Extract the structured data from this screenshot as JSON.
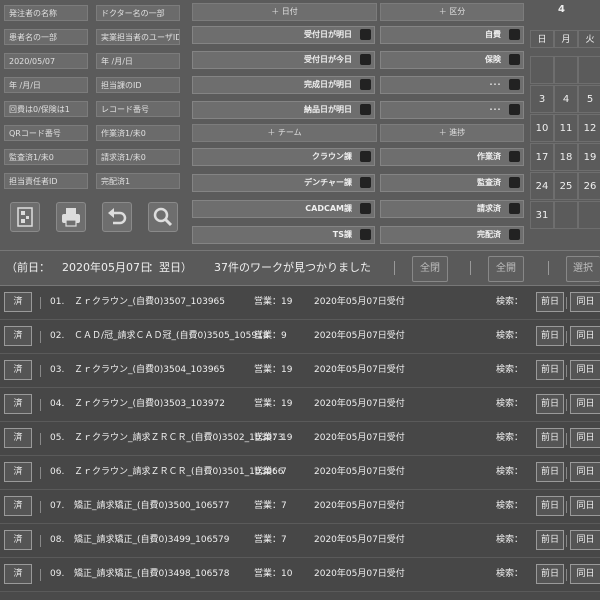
{
  "filters": {
    "left": [
      "発注者の名称",
      "患者名の一部",
      "2020/05/07",
      "年 /月/日",
      "回費は0/保険は1",
      "QRコード番号",
      "監査済1/未0",
      "担当責任者ID"
    ],
    "right": [
      "ドクター名の一部",
      "実業担当者のユーザID",
      "年 /月/日",
      "担当課のID",
      "レコード番号",
      "作業済1/未0",
      "請求済1/未0",
      "完配済1"
    ]
  },
  "middle": {
    "date_group": "＋ 日付",
    "kubun_group": "＋ 区分",
    "team_group": "＋ チーム",
    "progress_group": "＋ 進捗",
    "date_buttons": [
      "受付日が明日",
      "受付日が今日",
      "完成日が明日",
      "納品日が明日"
    ],
    "kubun_buttons": [
      "自費",
      "保険",
      "･･･",
      "･･･"
    ],
    "team_buttons": [
      "クラウン課",
      "デンチャー課",
      "CADCAM課",
      "TS課"
    ],
    "progress_buttons": [
      "作業済",
      "監査済",
      "請求済",
      "完配済"
    ]
  },
  "calendar": {
    "month": "4",
    "dow": [
      "日",
      "月",
      "火"
    ],
    "weeks": [
      [
        "",
        "",
        ""
      ],
      [
        "3",
        "4",
        "5"
      ],
      [
        "10",
        "11",
        "12"
      ],
      [
        "17",
        "18",
        "19"
      ],
      [
        "24",
        "25",
        "26"
      ],
      [
        "31",
        "",
        ""
      ]
    ]
  },
  "status": {
    "prev": "（前日：",
    "date": "2020年05月07日",
    "next": "：翌日）",
    "count": "37件のワークが見つかりました",
    "close_all": "全閉",
    "open_all": "全開",
    "select": "選択"
  },
  "rows": [
    {
      "done": "済",
      "no": "01.",
      "name": "Ｚｒクラウン_(自費0)3507_103965",
      "sales": "営業：19",
      "recv": "2020年05月07日受付",
      "search": "検索：",
      "prev": "前日",
      "same": "同日"
    },
    {
      "done": "済",
      "no": "02.",
      "name": "ＣＡＤ/冠_請求ＣＡＤ冠_(自費0)3505_105918",
      "sales": "営業：9",
      "recv": "2020年05月07日受付",
      "search": "検索：",
      "prev": "前日",
      "same": "同日"
    },
    {
      "done": "済",
      "no": "03.",
      "name": "Ｚｒクラウン_(自費0)3504_103965",
      "sales": "営業：19",
      "recv": "2020年05月07日受付",
      "search": "検索：",
      "prev": "前日",
      "same": "同日"
    },
    {
      "done": "済",
      "no": "04.",
      "name": "Ｚｒクラウン_(自費0)3503_103972",
      "sales": "営業：19",
      "recv": "2020年05月07日受付",
      "search": "検索：",
      "prev": "前日",
      "same": "同日"
    },
    {
      "done": "済",
      "no": "05.",
      "name": "Ｚｒクラウン_請求ＺＲＣＲ_(自費0)3502_103973",
      "sales": "営業：19",
      "recv": "2020年05月07日受付",
      "search": "検索：",
      "prev": "前日",
      "same": "同日"
    },
    {
      "done": "済",
      "no": "06.",
      "name": "Ｚｒクラウン_請求ＺＲＣＲ_(自費0)3501_103966",
      "sales": "営業：7",
      "recv": "2020年05月07日受付",
      "search": "検索：",
      "prev": "前日",
      "same": "同日"
    },
    {
      "done": "済",
      "no": "07.",
      "name": "矯正_請求矯正_(自費0)3500_106577",
      "sales": "営業：7",
      "recv": "2020年05月07日受付",
      "search": "検索：",
      "prev": "前日",
      "same": "同日"
    },
    {
      "done": "済",
      "no": "08.",
      "name": "矯正_請求矯正_(自費0)3499_106579",
      "sales": "営業：7",
      "recv": "2020年05月07日受付",
      "search": "検索：",
      "prev": "前日",
      "same": "同日"
    },
    {
      "done": "済",
      "no": "09.",
      "name": "矯正_請求矯正_(自費0)3498_106578",
      "sales": "営業：10",
      "recv": "2020年05月07日受付",
      "search": "検索：",
      "prev": "前日",
      "same": "同日"
    }
  ]
}
